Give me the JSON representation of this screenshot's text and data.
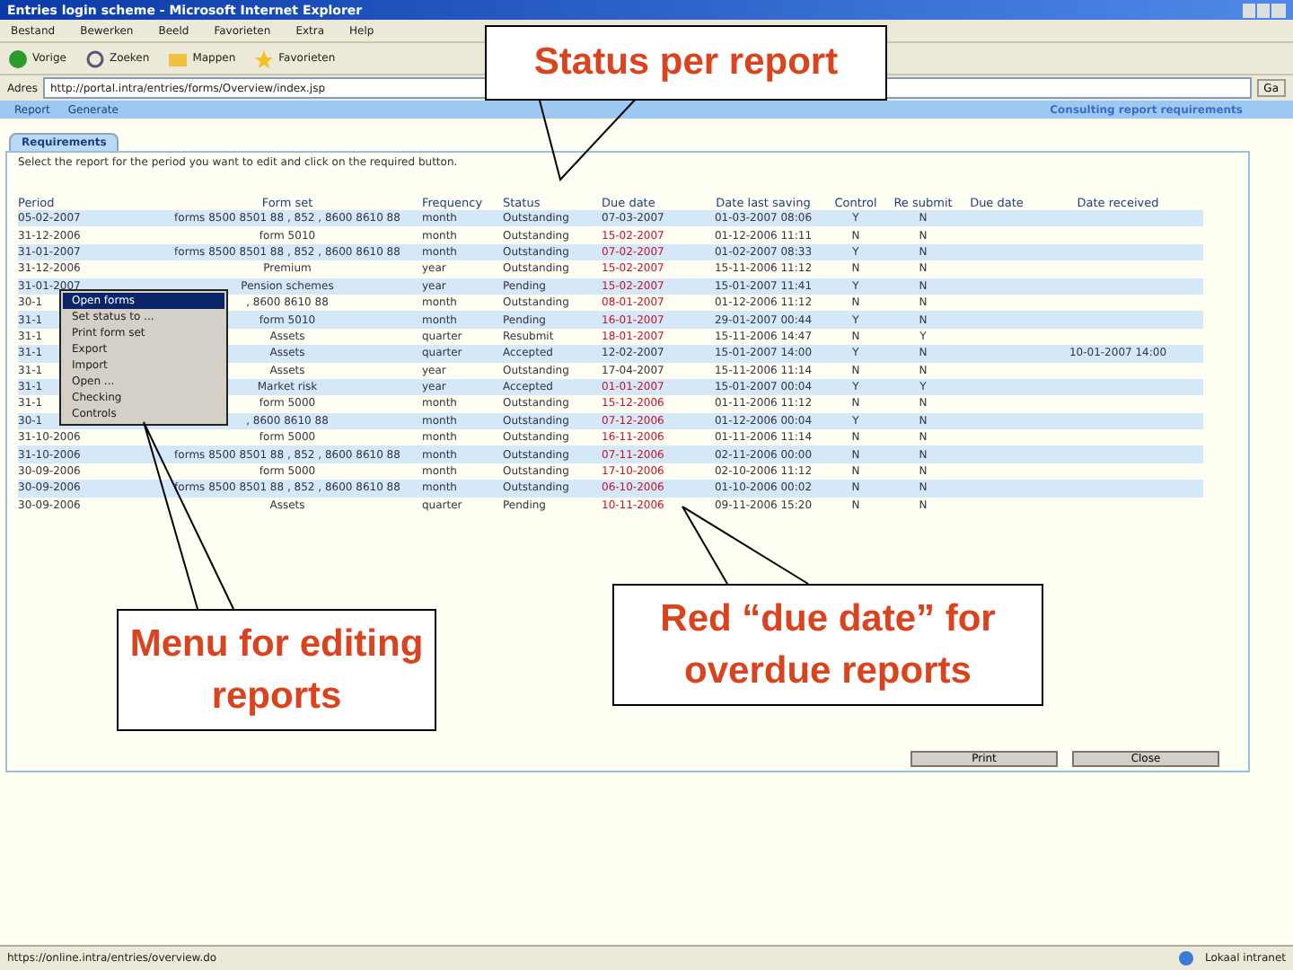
{
  "window": {
    "title": "Entries login scheme - Microsoft Internet Explorer"
  },
  "menu_bar": [
    "Bestand",
    "Bewerken",
    "Beeld",
    "Favorieten",
    "Extra",
    "Help"
  ],
  "toolbar": [
    "Vorige",
    "Zoeken",
    "Mappen",
    "Favorieten"
  ],
  "address": {
    "label": "Adres",
    "value": "http://portal.intra/entries/forms/Overview/index.jsp",
    "go": "Ga"
  },
  "nav": {
    "items": [
      "Report",
      "Generate"
    ],
    "title": "Consulting report requirements"
  },
  "tabs": [
    {
      "label": "Requirements",
      "selected": true
    }
  ],
  "instruction": "Select the report for the period you want to edit and click on the required button.",
  "table": {
    "columns": [
      "Period",
      "Form set",
      "Frequency",
      "Status",
      "Due date",
      "Date last saving",
      "Control",
      "Re submit",
      "Due date",
      "Date received"
    ],
    "rows": [
      {
        "period": "05-02-2007",
        "form_set": "forms 8500 8501 88 , 852 , 8600 8610 88",
        "frequency": "month",
        "status": "Outstanding",
        "due": "07-03-2007",
        "overdue": false,
        "saved": "01-03-2007 08:06",
        "control": "Y",
        "resubmit": "N"
      },
      {
        "period": "31-12-2006",
        "form_set": "form 5010",
        "frequency": "month",
        "status": "Outstanding",
        "due": "15-02-2007",
        "overdue": true,
        "saved": "01-12-2006 11:11",
        "control": "N",
        "resubmit": "N"
      },
      {
        "period": "31-01-2007",
        "form_set": "forms 8500 8501 88 , 852 , 8600 8610 88",
        "frequency": "month",
        "status": "Outstanding",
        "due": "07-02-2007",
        "overdue": true,
        "saved": "01-02-2007 08:33",
        "control": "Y",
        "resubmit": "N"
      },
      {
        "period": "31-12-2006",
        "form_set": "Premium",
        "frequency": "year",
        "status": "Outstanding",
        "due": "15-02-2007",
        "overdue": true,
        "saved": "15-11-2006 11:12",
        "control": "N",
        "resubmit": "N"
      },
      {
        "period": "31-01-2007",
        "form_set": "Pension schemes",
        "frequency": "year",
        "status": "Pending",
        "due": "15-02-2007",
        "overdue": true,
        "saved": "15-01-2007 11:41",
        "control": "Y",
        "resubmit": "N"
      },
      {
        "period": "30-1",
        "form_set": ", 8600 8610 88",
        "frequency": "month",
        "status": "Outstanding",
        "due": "08-01-2007",
        "overdue": true,
        "saved": "01-12-2006 11:12",
        "control": "N",
        "resubmit": "N"
      },
      {
        "period": "31-1",
        "form_set": "form 5010",
        "frequency": "month",
        "status": "Pending",
        "due": "16-01-2007",
        "overdue": true,
        "saved": "29-01-2007 00:44",
        "control": "Y",
        "resubmit": "N"
      },
      {
        "period": "31-1",
        "form_set": "Assets",
        "frequency": "quarter",
        "status": "Resubmit",
        "due": "18-01-2007",
        "overdue": true,
        "saved": "15-11-2006 14:47",
        "control": "N",
        "resubmit": "Y"
      },
      {
        "period": "31-1",
        "form_set": "Assets",
        "frequency": "quarter",
        "status": "Accepted",
        "due": "12-02-2007",
        "overdue": false,
        "saved": "15-01-2007 14:00",
        "control": "Y",
        "resubmit": "N",
        "received": "10-01-2007 14:00"
      },
      {
        "period": "31-1",
        "form_set": "Assets",
        "frequency": "year",
        "status": "Outstanding",
        "due": "17-04-2007",
        "overdue": false,
        "saved": "15-11-2006 11:14",
        "control": "N",
        "resubmit": "N"
      },
      {
        "period": "31-1",
        "form_set": "Market risk",
        "frequency": "year",
        "status": "Accepted",
        "due": "01-01-2007",
        "overdue": true,
        "saved": "15-01-2007 00:04",
        "control": "Y",
        "resubmit": "Y"
      },
      {
        "period": "31-1",
        "form_set": "form 5000",
        "frequency": "month",
        "status": "Outstanding",
        "due": "15-12-2006",
        "overdue": true,
        "saved": "01-11-2006 11:12",
        "control": "N",
        "resubmit": "N"
      },
      {
        "period": "30-1",
        "form_set": ", 8600 8610 88",
        "frequency": "month",
        "status": "Outstanding",
        "due": "07-12-2006",
        "overdue": true,
        "saved": "01-12-2006 00:04",
        "control": "Y",
        "resubmit": "N"
      },
      {
        "period": "31-10-2006",
        "form_set": "form 5000",
        "frequency": "month",
        "status": "Outstanding",
        "due": "16-11-2006",
        "overdue": true,
        "saved": "01-11-2006 11:14",
        "control": "N",
        "resubmit": "N"
      },
      {
        "period": "31-10-2006",
        "form_set": "forms 8500 8501 88 , 852 , 8600 8610 88",
        "frequency": "month",
        "status": "Outstanding",
        "due": "07-11-2006",
        "overdue": true,
        "saved": "02-11-2006 00:00",
        "control": "N",
        "resubmit": "N"
      },
      {
        "period": "30-09-2006",
        "form_set": "form 5000",
        "frequency": "month",
        "status": "Outstanding",
        "due": "17-10-2006",
        "overdue": true,
        "saved": "02-10-2006 11:12",
        "control": "N",
        "resubmit": "N"
      },
      {
        "period": "30-09-2006",
        "form_set": "forms 8500 8501 88 , 852 , 8600 8610 88",
        "frequency": "month",
        "status": "Outstanding",
        "due": "06-10-2006",
        "overdue": true,
        "saved": "01-10-2006 00:02",
        "control": "N",
        "resubmit": "N"
      },
      {
        "period": "30-09-2006",
        "form_set": "Assets",
        "frequency": "quarter",
        "status": "Pending",
        "due": "10-11-2006",
        "overdue": true,
        "saved": "09-11-2006 15:20",
        "control": "N",
        "resubmit": "N"
      }
    ]
  },
  "context_menu": [
    {
      "label": "Open forms",
      "selected": true
    },
    {
      "label": "Set status to ...",
      "selected": false
    },
    {
      "label": "Print form set",
      "selected": false
    },
    {
      "label": "Export",
      "selected": false
    },
    {
      "label": "Import",
      "selected": false
    },
    {
      "label": "Open ...",
      "selected": false
    },
    {
      "label": "Checking",
      "selected": false
    },
    {
      "label": "Controls",
      "selected": false
    }
  ],
  "buttons": [
    "Print",
    "Close"
  ],
  "status_bar": {
    "url": "https://online.intra/entries/overview.do",
    "zone": "Lokaal intranet"
  },
  "callouts": [
    {
      "text": "Status per report"
    },
    {
      "text": "Menu for editing reports"
    },
    {
      "text": "Red “due date” for overdue reports"
    }
  ]
}
